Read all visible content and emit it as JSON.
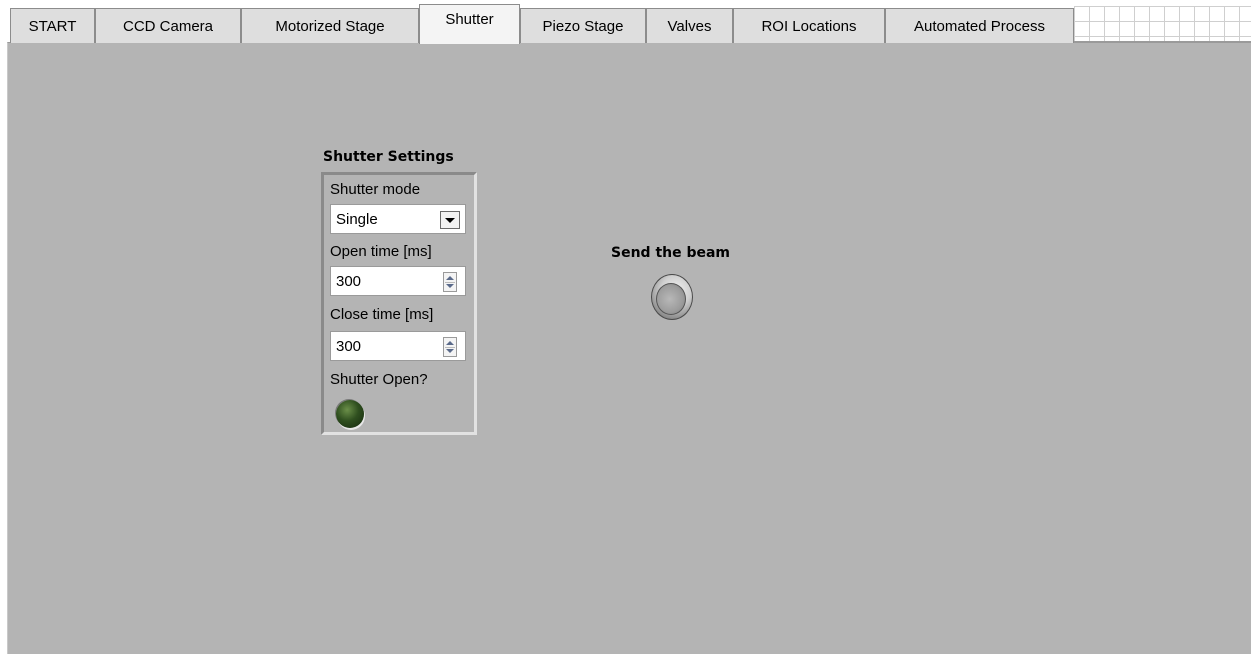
{
  "tabs": [
    {
      "label": "START",
      "active": false
    },
    {
      "label": "CCD Camera",
      "active": false
    },
    {
      "label": "Motorized Stage",
      "active": false
    },
    {
      "label": "Shutter",
      "active": true
    },
    {
      "label": "Piezo Stage",
      "active": false
    },
    {
      "label": "Valves",
      "active": false
    },
    {
      "label": "ROI Locations",
      "active": false
    },
    {
      "label": "Automated Process",
      "active": false
    }
  ],
  "shutter_settings": {
    "title": "Shutter Settings",
    "mode_label": "Shutter mode",
    "mode_value": "Single",
    "open_time_label": "Open time [ms]",
    "open_time_value": "300",
    "close_time_label": "Close time [ms]",
    "close_time_value": "300",
    "shutter_open_label": "Shutter Open?",
    "shutter_open_state": "off"
  },
  "beam": {
    "label": "Send the beam",
    "state": "off"
  },
  "colors": {
    "panel_bg": "#b4b4b4",
    "tab_bg": "#dedede",
    "active_tab_bg": "#f4f4f4",
    "led_off": "#2f4f1f"
  }
}
